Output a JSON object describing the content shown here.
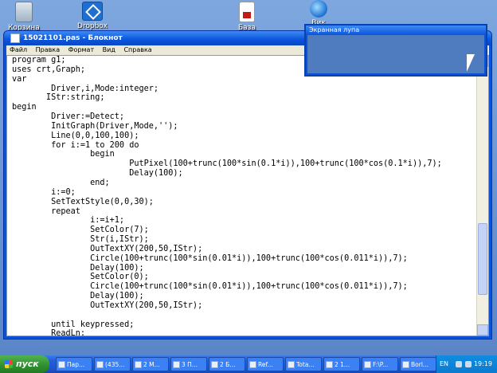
{
  "desktop": {
    "icons": [
      {
        "label": "Корзина"
      },
      {
        "label": "Dropbox"
      },
      {
        "label": "База данных"
      },
      {
        "label": "Вик"
      }
    ]
  },
  "notepad": {
    "title": "15021101.pas - Блокнот",
    "menu": [
      "Файл",
      "Правка",
      "Формат",
      "Вид",
      "Справка"
    ],
    "code": [
      "program g1;",
      "uses crt,Graph;",
      "var",
      "        Driver,i,Mode:integer;",
      "       IStr:string;",
      "begin",
      "        Driver:=Detect;",
      "        InitGraph(Driver,Mode,'');",
      "        Line(0,0,100,100);",
      "        for i:=1 to 200 do",
      "                begin",
      "                        PutPixel(100+trunc(100*sin(0.1*i)),100+trunc(100*cos(0.1*i)),7);",
      "                        Delay(100);",
      "                end;",
      "        i:=0;",
      "        SetTextStyle(0,0,30);",
      "        repeat",
      "                i:=i+1;",
      "                SetColor(7);",
      "                Str(i,IStr);",
      "                OutTextXY(200,50,IStr);",
      "                Circle(100+trunc(100*sin(0.01*i)),100+trunc(100*cos(0.011*i)),7);",
      "                Delay(100);",
      "                SetColor(0);",
      "                Circle(100+trunc(100*sin(0.01*i)),100+trunc(100*cos(0.011*i)),7);",
      "                Delay(100);",
      "                OutTextXY(200,50,IStr);",
      "",
      "        until keypressed;",
      "        ReadLn;"
    ]
  },
  "magnifier": {
    "title": "Экранная лупа"
  },
  "taskbar": {
    "start_label": "пуск",
    "tasks": [
      {
        "label": "Пар..."
      },
      {
        "label": "(435..."
      },
      {
        "label": "2 M..."
      },
      {
        "label": "3 П..."
      },
      {
        "label": "2 Б..."
      },
      {
        "label": "Ref..."
      },
      {
        "label": "Tota..."
      },
      {
        "label": "2 1..."
      },
      {
        "label": "F:\\P..."
      },
      {
        "label": "Borl..."
      }
    ],
    "language": "EN",
    "clock": "19:19"
  }
}
